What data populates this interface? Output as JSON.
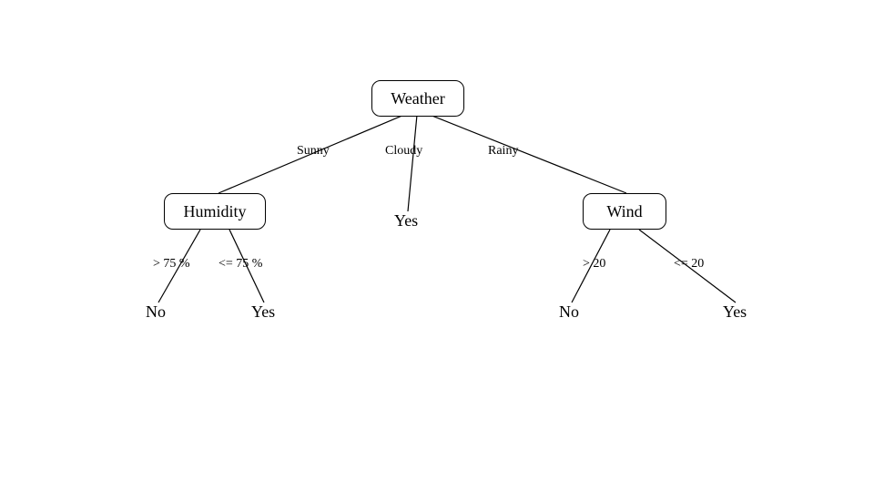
{
  "chart_data": {
    "type": "decision-tree",
    "root": {
      "label": "Weather",
      "children": [
        {
          "edge": "Sunny",
          "label": "Humidity",
          "children": [
            {
              "edge": "> 75 %",
              "leaf": "No"
            },
            {
              "edge": "<= 75 %",
              "leaf": "Yes"
            }
          ]
        },
        {
          "edge": "Cloudy",
          "leaf": "Yes"
        },
        {
          "edge": "Rainy",
          "label": "Wind",
          "children": [
            {
              "edge": "> 20",
              "leaf": "No"
            },
            {
              "edge": "<= 20",
              "leaf": "Yes"
            }
          ]
        }
      ]
    }
  },
  "nodes": {
    "weather": "Weather",
    "humidity": "Humidity",
    "wind": "Wind",
    "cloudy_leaf": "Yes",
    "humidity_no": "No",
    "humidity_yes": "Yes",
    "wind_no": "No",
    "wind_yes": "Yes"
  },
  "edges": {
    "sunny": "Sunny",
    "cloudy": "Cloudy",
    "rainy": "Rainy",
    "humidity_gt": "> 75 %",
    "humidity_le": "<= 75 %",
    "wind_gt": "> 20",
    "wind_le": "<= 20"
  }
}
